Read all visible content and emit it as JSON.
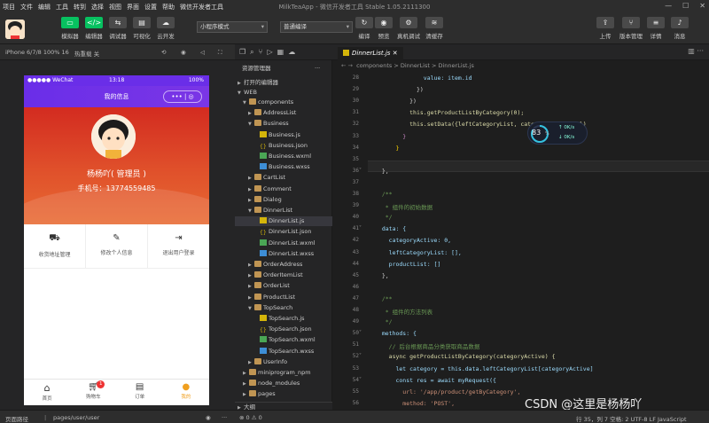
{
  "menubar": {
    "items": [
      "项目",
      "文件",
      "编辑",
      "工具",
      "转到",
      "选择",
      "视图",
      "界面",
      "设置",
      "帮助",
      "微信开发者工具"
    ],
    "title": "MilkTeaApp - 微信开发者工具 Stable 1.05.2111300"
  },
  "toolbar": {
    "left_buttons": [
      "模拟器",
      "编辑器",
      "调试器",
      "可视化",
      "云开发"
    ],
    "mode_select": "小程序模式",
    "compile_select": "普通编译",
    "mid_buttons": [
      "编译",
      "预览",
      "真机调试",
      "清缓存"
    ],
    "right_buttons": [
      "上传",
      "版本管理",
      "详情",
      "消息"
    ]
  },
  "simulator": {
    "device": "iPhone 6/7/8 100% 16",
    "hotreload": "热重载 关",
    "status_carrier": "●●●●● WeChat",
    "status_time": "13:18",
    "status_battery": "100%",
    "nav_title": "我的信息",
    "username": "杨杨吖( 管理员 )",
    "phone": "手机号：13774559485",
    "menu": [
      "收货地址管理",
      "修改个人信息",
      "退出用户登录"
    ],
    "tabs": [
      "首页",
      "购物车",
      "订单",
      "我的"
    ],
    "cart_badge": "1"
  },
  "explorer": {
    "title": "资源管理器",
    "sections": [
      "打开的编辑器",
      "WEB"
    ],
    "tree": [
      {
        "depth": 1,
        "type": "folder",
        "open": true,
        "name": "components"
      },
      {
        "depth": 2,
        "type": "folder",
        "open": false,
        "name": "AddressList"
      },
      {
        "depth": 2,
        "type": "folder",
        "open": true,
        "name": "Business"
      },
      {
        "depth": 3,
        "type": "js",
        "name": "Business.js"
      },
      {
        "depth": 3,
        "type": "json",
        "name": "Business.json"
      },
      {
        "depth": 3,
        "type": "wxml",
        "name": "Business.wxml"
      },
      {
        "depth": 3,
        "type": "wxss",
        "name": "Business.wxss"
      },
      {
        "depth": 2,
        "type": "folder",
        "open": false,
        "name": "CartList"
      },
      {
        "depth": 2,
        "type": "folder",
        "open": false,
        "name": "Comment"
      },
      {
        "depth": 2,
        "type": "folder",
        "open": false,
        "name": "Dialog"
      },
      {
        "depth": 2,
        "type": "folder",
        "open": true,
        "name": "DinnerList"
      },
      {
        "depth": 3,
        "type": "js",
        "name": "DinnerList.js",
        "selected": true
      },
      {
        "depth": 3,
        "type": "json",
        "name": "DinnerList.json"
      },
      {
        "depth": 3,
        "type": "wxml",
        "name": "DinnerList.wxml"
      },
      {
        "depth": 3,
        "type": "wxss",
        "name": "DinnerList.wxss"
      },
      {
        "depth": 2,
        "type": "folder",
        "open": false,
        "name": "OrderAddress"
      },
      {
        "depth": 2,
        "type": "folder",
        "open": false,
        "name": "OrderItemList"
      },
      {
        "depth": 2,
        "type": "folder",
        "open": false,
        "name": "OrderList"
      },
      {
        "depth": 2,
        "type": "folder",
        "open": false,
        "name": "ProductList"
      },
      {
        "depth": 2,
        "type": "folder",
        "open": true,
        "name": "TopSearch"
      },
      {
        "depth": 3,
        "type": "js",
        "name": "TopSearch.js"
      },
      {
        "depth": 3,
        "type": "json",
        "name": "TopSearch.json"
      },
      {
        "depth": 3,
        "type": "wxml",
        "name": "TopSearch.wxml"
      },
      {
        "depth": 3,
        "type": "wxss",
        "name": "TopSearch.wxss"
      },
      {
        "depth": 2,
        "type": "folder",
        "open": false,
        "name": "UserInfo"
      },
      {
        "depth": 1,
        "type": "folder",
        "open": false,
        "name": "miniprogram_npm"
      },
      {
        "depth": 1,
        "type": "folder",
        "open": false,
        "name": "node_modules"
      },
      {
        "depth": 1,
        "type": "folder",
        "open": false,
        "name": "pages"
      }
    ],
    "outline": "大纲"
  },
  "editor": {
    "tab": "DinnerList.js",
    "breadcrumb": "components > DinnerList > DinnerList.js",
    "lines": [
      {
        "n": "28",
        "t": "              value: item.id",
        "c": "#9cdcfe"
      },
      {
        "n": "29",
        "t": "            })",
        "c": "#d4d4d4"
      },
      {
        "n": "30",
        "t": "          })",
        "c": "#d4d4d4"
      },
      {
        "n": "31",
        "t": "          this.getProductListByCategory(0);",
        "c": "#dcdcaa"
      },
      {
        "n": "32",
        "t": "          this.setData({leftCategoryList, categoryActive: 0})",
        "c": "#dcdcaa"
      },
      {
        "n": "33",
        "t": "        }",
        "c": "#c586c0"
      },
      {
        "n": "34",
        "t": "      }",
        "c": "#ffd700"
      },
      {
        "n": "35",
        "t": "",
        "c": "#d4d4d4"
      },
      {
        "n": "36",
        "t": "  },",
        "c": "#d4d4d4"
      },
      {
        "n": "37",
        "t": "",
        "c": "#d4d4d4"
      },
      {
        "n": "38",
        "t": "  /**",
        "c": "#6a9955"
      },
      {
        "n": "39",
        "t": "   * 组件的初始数据",
        "c": "#6a9955"
      },
      {
        "n": "40",
        "t": "   */",
        "c": "#6a9955"
      },
      {
        "n": "41",
        "t": "  data: {",
        "c": "#9cdcfe"
      },
      {
        "n": "42",
        "t": "    categoryActive: 0,",
        "c": "#9cdcfe"
      },
      {
        "n": "43",
        "t": "    leftCategoryList: [],",
        "c": "#9cdcfe"
      },
      {
        "n": "44",
        "t": "    productList: []",
        "c": "#9cdcfe"
      },
      {
        "n": "45",
        "t": "  },",
        "c": "#d4d4d4"
      },
      {
        "n": "46",
        "t": "",
        "c": "#d4d4d4"
      },
      {
        "n": "47",
        "t": "  /**",
        "c": "#6a9955"
      },
      {
        "n": "48",
        "t": "   * 组件的方法列表",
        "c": "#6a9955"
      },
      {
        "n": "49",
        "t": "   */",
        "c": "#6a9955"
      },
      {
        "n": "50",
        "t": "  methods: {",
        "c": "#9cdcfe"
      },
      {
        "n": "51",
        "t": "    // 后台根据商品分类获取商品数据",
        "c": "#6a9955"
      },
      {
        "n": "52",
        "t": "    async getProductListByCategory(categoryActive) {",
        "c": "#dcdcaa"
      },
      {
        "n": "53",
        "t": "      let category = this.data.leftCategoryList[categoryActive]",
        "c": "#9cdcfe"
      },
      {
        "n": "54",
        "t": "      const res = await myRequest({",
        "c": "#9cdcfe"
      },
      {
        "n": "55",
        "t": "        url: '/app/product/getByCategory',",
        "c": "#ce9178"
      },
      {
        "n": "56",
        "t": "        method: 'POST',",
        "c": "#ce9178"
      }
    ]
  },
  "perf": {
    "percent": "83",
    "unit": "%",
    "up": "0K/s",
    "down": "0K/s"
  },
  "statusbar": {
    "left": "页面路径",
    "path": "pages/user/user",
    "errors": "⊗ 0 ⚠ 0",
    "right": "行 35，列 7   空格: 2   UTF-8   LF   JavaScript"
  },
  "watermark": "CSDN @这里是杨杨吖"
}
